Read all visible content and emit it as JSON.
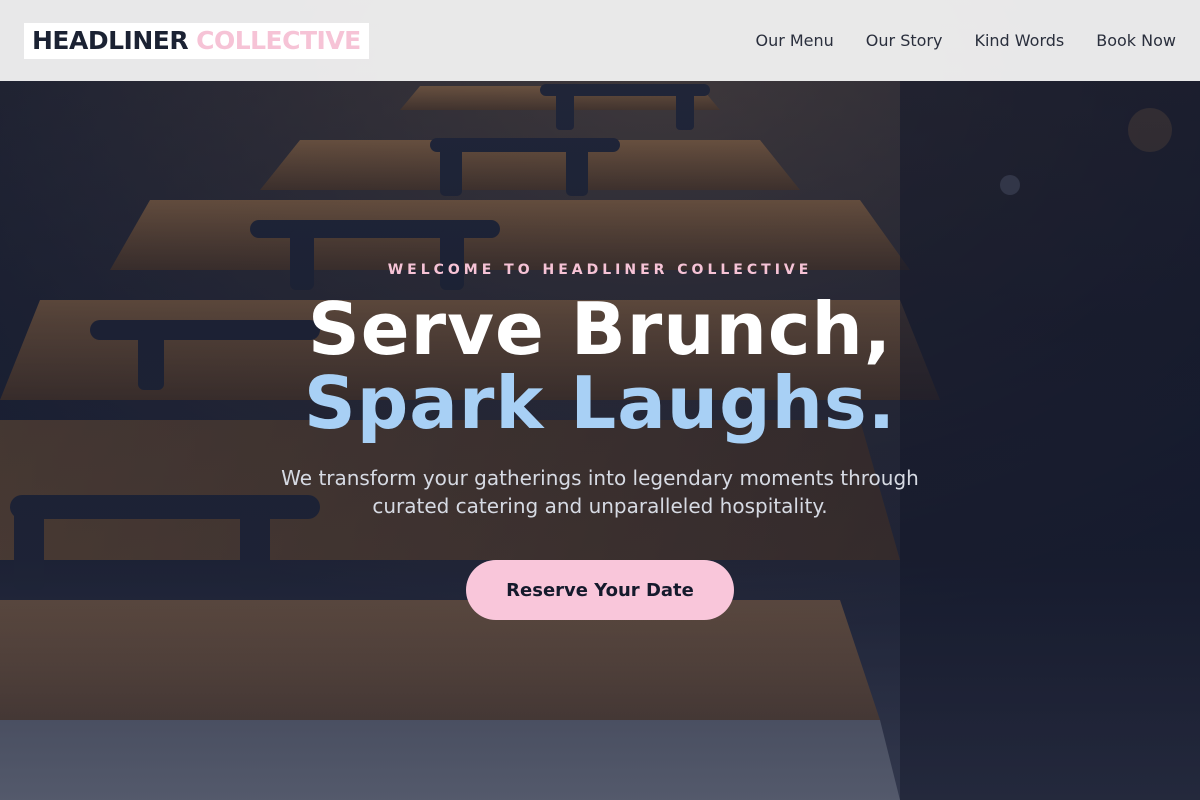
{
  "header": {
    "logo_primary": "HEADLINER",
    "logo_accent": "COLLECTIVE",
    "nav": [
      {
        "label": "Our Menu"
      },
      {
        "label": "Our Story"
      },
      {
        "label": "Kind Words"
      },
      {
        "label": "Book Now"
      }
    ]
  },
  "hero": {
    "eyebrow": "WELCOME TO HEADLINER COLLECTIVE",
    "title_line1": "Serve Brunch,",
    "title_line2": "Spark Laughs.",
    "subtitle": "We transform your gatherings into legendary moments through curated catering and unparalleled hospitality.",
    "cta_label": "Reserve Your Date",
    "background_image": "catering-chafing-dishes-photo"
  },
  "colors": {
    "accent_pink": "#f9c6da",
    "accent_blue": "#a8d0f5",
    "header_bg": "#f0f0f0",
    "text_dark": "#1b2233"
  }
}
